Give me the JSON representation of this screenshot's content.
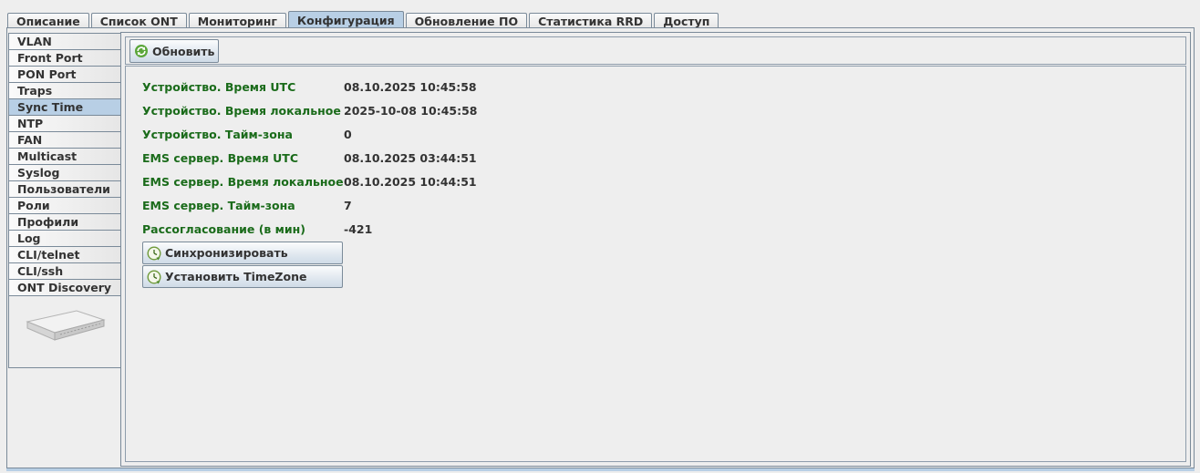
{
  "top_tabs": [
    {
      "label": "Описание",
      "active": false
    },
    {
      "label": "Список ONT",
      "active": false
    },
    {
      "label": "Мониторинг",
      "active": false
    },
    {
      "label": "Конфигурация",
      "active": true
    },
    {
      "label": "Обновление ПО",
      "active": false
    },
    {
      "label": "Статистика RRD",
      "active": false
    },
    {
      "label": "Доступ",
      "active": false
    }
  ],
  "left_tabs": [
    {
      "label": "VLAN",
      "active": false
    },
    {
      "label": "Front Port",
      "active": false
    },
    {
      "label": "PON Port",
      "active": false
    },
    {
      "label": "Traps",
      "active": false
    },
    {
      "label": "Sync Time",
      "active": true
    },
    {
      "label": "NTP",
      "active": false
    },
    {
      "label": "FAN",
      "active": false
    },
    {
      "label": "Multicast",
      "active": false
    },
    {
      "label": "Syslog",
      "active": false
    },
    {
      "label": "Пользователи",
      "active": false
    },
    {
      "label": "Роли",
      "active": false
    },
    {
      "label": "Профили",
      "active": false
    },
    {
      "label": "Log",
      "active": false
    },
    {
      "label": "CLI/telnet",
      "active": false
    },
    {
      "label": "CLI/ssh",
      "active": false
    },
    {
      "label": "ONT Discovery",
      "active": false
    }
  ],
  "toolbar": {
    "refresh_label": "Обновить",
    "refresh_icon": "refresh-icon"
  },
  "fields": [
    {
      "label": "Устройство. Время UTC",
      "value": "08.10.2025 10:45:58"
    },
    {
      "label": "Устройство. Время локальное",
      "value": "2025-10-08 10:45:58"
    },
    {
      "label": "Устройство. Тайм-зона",
      "value": "0"
    },
    {
      "label": "EMS сервер. Время UTC",
      "value": "08.10.2025 03:44:51"
    },
    {
      "label": "EMS сервер. Время локальное",
      "value": "08.10.2025 10:44:51"
    },
    {
      "label": "EMS сервер. Тайм-зона",
      "value": "7"
    },
    {
      "label": "Рассогласование (в мин)",
      "value": "-421"
    }
  ],
  "actions": {
    "sync_label": "Синхронизировать",
    "set_tz_label": "Установить TimeZone",
    "icon": "clock-icon"
  },
  "colors": {
    "label_green": "#1a6b1a",
    "active_tab": "#b8cfe5",
    "border": "#7a8a99"
  }
}
